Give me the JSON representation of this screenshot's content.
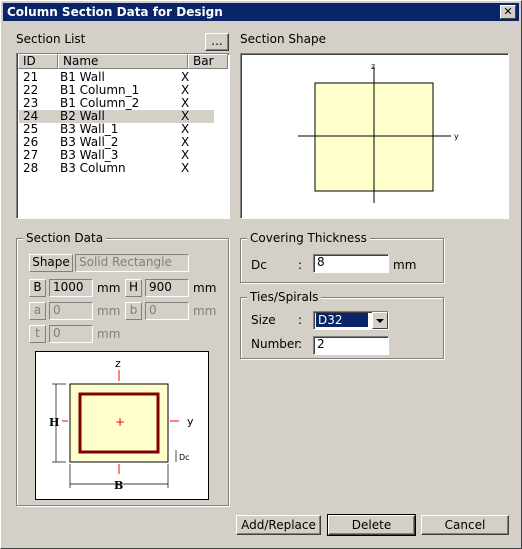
{
  "window": {
    "title": "Column Section Data for Design",
    "close_glyph": "✕"
  },
  "section_list": {
    "label": "Section List",
    "browse_label": "...",
    "columns": {
      "id": "ID",
      "name": "Name",
      "bar": "Bar"
    },
    "rows": [
      {
        "id": "21",
        "name": "B1 Wall",
        "bar": "X"
      },
      {
        "id": "22",
        "name": "B1 Column_1",
        "bar": "X"
      },
      {
        "id": "23",
        "name": "B1 Column_2",
        "bar": "X"
      },
      {
        "id": "24",
        "name": "B2 Wall",
        "bar": "X"
      },
      {
        "id": "25",
        "name": "B3 Wall_1",
        "bar": "X"
      },
      {
        "id": "26",
        "name": "B3 Wall_2",
        "bar": "X"
      },
      {
        "id": "27",
        "name": "B3 Wall_3",
        "bar": "X"
      },
      {
        "id": "28",
        "name": "B3 Column",
        "bar": "X"
      }
    ],
    "selected_id": "24"
  },
  "section_shape": {
    "label": "Section Shape",
    "axis_z": "z",
    "axis_y": "y",
    "fill_color": "#ffffcc"
  },
  "section_data": {
    "label": "Section Data",
    "shape_label": "Shape",
    "shape_value": "Solid Rectangle",
    "b_label": "B",
    "b_value": "1000",
    "b_unit": "mm",
    "h_label": "H",
    "h_value": "900",
    "h_unit": "mm",
    "a_label": "a",
    "a_value": "0",
    "a_unit": "mm",
    "bb_label": "b",
    "bb_value": "0",
    "bb_unit": "mm",
    "t_label": "t",
    "t_value": "0",
    "t_unit": "mm",
    "diagram": {
      "z": "z",
      "y": "y",
      "h": "H",
      "b": "B",
      "dc": "Dc",
      "center": "+",
      "rebar_color": "#800000",
      "axis_color": "#ff0000"
    }
  },
  "covering": {
    "label": "Covering Thickness",
    "dc_label": "Dc",
    "colon": ":",
    "dc_value": "8",
    "dc_unit": "mm"
  },
  "ties": {
    "label": "Ties/Spirals",
    "size_label": "Size",
    "colon": ":",
    "size_value": "D32",
    "number_label": "Number",
    "number_colon": ":",
    "number_value": "2"
  },
  "buttons": {
    "add_replace": "Add/Replace",
    "delete": "Delete",
    "cancel": "Cancel"
  }
}
